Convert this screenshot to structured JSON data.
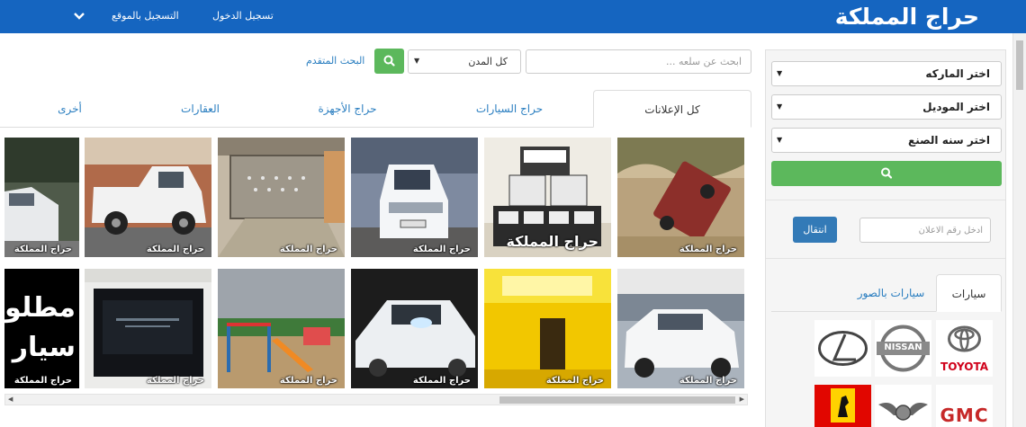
{
  "header": {
    "logo_text": "حراج المملكة",
    "login_label": "تسجيل الدخول",
    "register_label": "التسجيل بالموقع",
    "menu_icon": "chevron-down-icon",
    "bar_color": "#1565c0"
  },
  "search": {
    "placeholder": "ابحث عن سلعه ...",
    "city_selected": "كل المدن",
    "search_icon": "search-icon",
    "advanced_label": "البحث المتقدم"
  },
  "tabs": [
    {
      "label": "كل الإعلانات",
      "active": true
    },
    {
      "label": "حراج السيارات",
      "active": false
    },
    {
      "label": "حراج الأجهزة",
      "active": false
    },
    {
      "label": "العقارات",
      "active": false
    },
    {
      "label": "أخرى",
      "active": false
    }
  ],
  "listings": {
    "watermark": "حراج المملكة",
    "row1": [
      {
        "subject": "red-pickup-desert"
      },
      {
        "subject": "playstation-boxes"
      },
      {
        "subject": "white-toyota-sedan"
      },
      {
        "subject": "bed-frame"
      },
      {
        "subject": "white-hilux-pickup"
      },
      {
        "subject": "white-mercedes-partial"
      }
    ],
    "row2": [
      {
        "subject": "white-toyota-camry"
      },
      {
        "subject": "yellow-lit-room"
      },
      {
        "subject": "white-mercedes-cls"
      },
      {
        "subject": "playground-slides"
      },
      {
        "subject": "tv-on-wall"
      },
      {
        "subject": "text-ad-partial"
      }
    ],
    "text_ad_lines": [
      "مطلو",
      "سيار"
    ]
  },
  "sidebar": {
    "brand_select": "اختر الماركه",
    "model_select": "اختر الموديل",
    "year_select": "اختر سنه الصنع",
    "go_icon": "search-icon",
    "ad_number_placeholder": "ادخل رقم الاعلان",
    "move_label": "انتقال",
    "tab_cars": "سيارات",
    "tab_cars_photos": "سيارات بالصور",
    "brands": [
      {
        "name": "TOYOTA",
        "color": "#d0021b"
      },
      {
        "name": "NISSAN",
        "color": "#555555"
      },
      {
        "name": "LEXUS",
        "color": "#333333"
      },
      {
        "name": "GMC",
        "color": "#c62828"
      },
      {
        "name": "BENTLEY",
        "color": "#444444"
      },
      {
        "name": "FERRARI",
        "color": "#e10600"
      }
    ]
  },
  "colors": {
    "accent_green": "#5cb85c",
    "primary_blue": "#337ab7",
    "link_blue": "#2a7ec0"
  }
}
